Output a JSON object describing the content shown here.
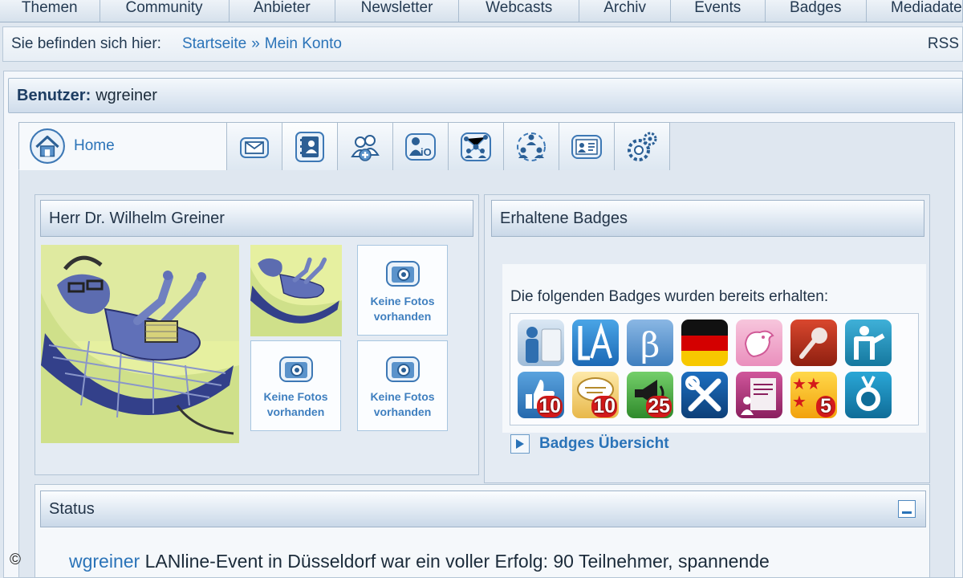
{
  "nav": {
    "items": [
      "Themen",
      "Community",
      "Anbieter",
      "Newsletter",
      "Webcasts",
      "Archiv",
      "Events",
      "Badges",
      "Mediadaten"
    ]
  },
  "breadcrumb": {
    "prefix": "Sie befinden sich hier:",
    "items": [
      "Startseite",
      "Mein Konto"
    ],
    "separator": "»",
    "rss": "RSS"
  },
  "user": {
    "label": "Benutzer:",
    "name": "wgreiner"
  },
  "tabs": {
    "home": "Home",
    "icons": [
      "mail-icon",
      "address-book-icon",
      "add-friends-icon",
      "user-info-icon",
      "network-icon",
      "groups-icon",
      "business-card-icon",
      "settings-icon"
    ]
  },
  "profile": {
    "name": "Herr Dr. Wilhelm Greiner",
    "no_photos": [
      "Keine Fotos vorhanden",
      "Keine Fotos vorhanden",
      "Keine Fotos vorhanden"
    ]
  },
  "badges": {
    "title": "Erhaltene Badges",
    "intro": "Die folgenden Badges wurden bereits erhalten:",
    "items": [
      {
        "icon": "profile-person-badge",
        "num": ""
      },
      {
        "icon": "la-logo-badge",
        "num": ""
      },
      {
        "icon": "beta-badge",
        "num": ""
      },
      {
        "icon": "german-flag-badge",
        "num": ""
      },
      {
        "icon": "twitter-bird-badge",
        "num": ""
      },
      {
        "icon": "microphone-badge",
        "num": ""
      },
      {
        "icon": "presenter-badge",
        "num": ""
      },
      {
        "icon": "thumbs-up-badge",
        "num": "10"
      },
      {
        "icon": "comment-badge",
        "num": "10"
      },
      {
        "icon": "megaphone-badge",
        "num": "25"
      },
      {
        "icon": "tools-badge",
        "num": ""
      },
      {
        "icon": "article-badge",
        "num": ""
      },
      {
        "icon": "stars-badge",
        "num": "5"
      },
      {
        "icon": "medal-badge",
        "num": ""
      }
    ],
    "overview_link": "Badges Übersicht"
  },
  "status": {
    "title": "Status",
    "user": "wgreiner",
    "text": "LANline-Event in Düsseldorf war ein voller Erfolg: 90 Teilnehmer, spannende"
  },
  "copyright": "©"
}
